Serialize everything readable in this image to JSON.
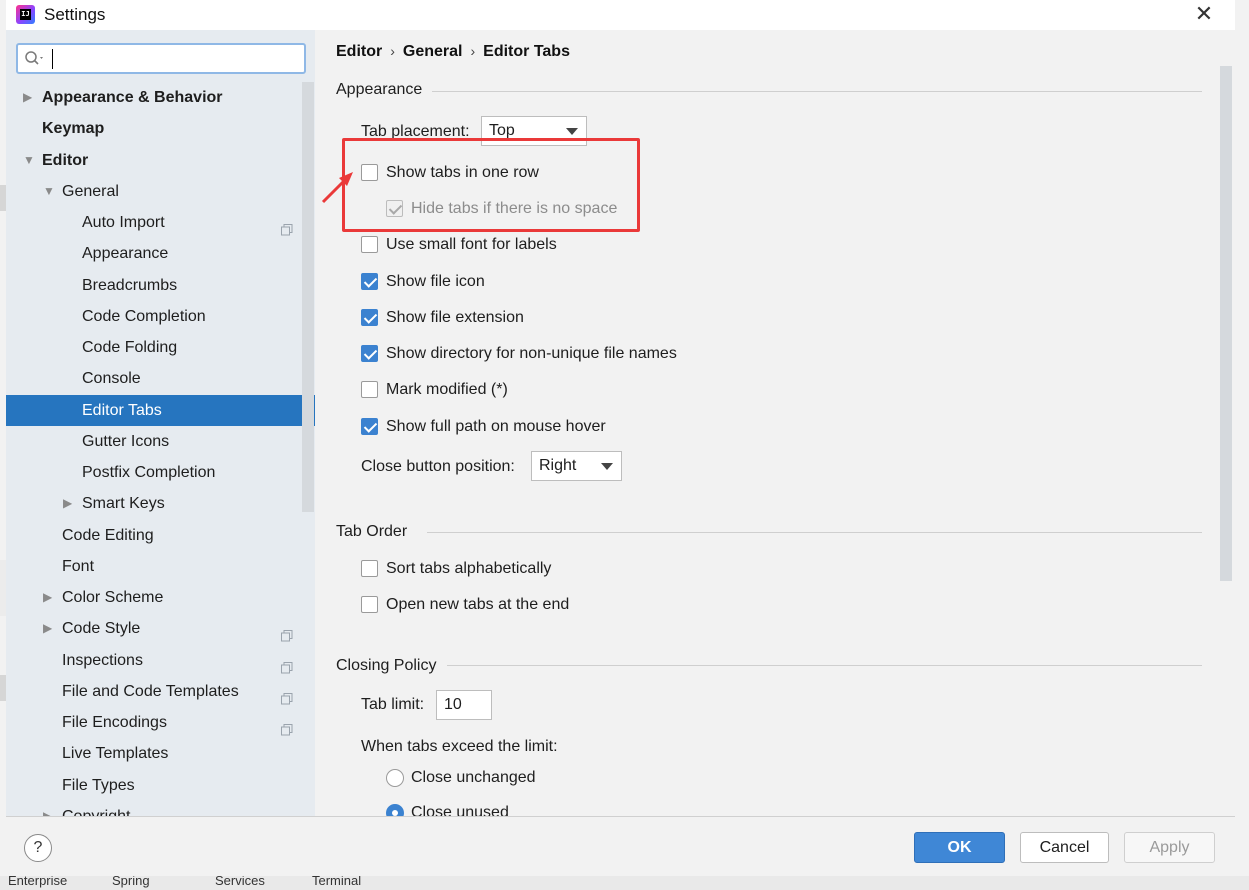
{
  "window": {
    "title": "Settings",
    "app_icon_text": "IJ"
  },
  "search": {
    "value": "",
    "placeholder": ""
  },
  "sidebar": {
    "items": [
      {
        "label": "Appearance & Behavior",
        "bold": true,
        "arrow": "collapsed",
        "level": 0
      },
      {
        "label": "Keymap",
        "bold": true,
        "arrow": "none",
        "level": 0
      },
      {
        "label": "Editor",
        "bold": true,
        "arrow": "expanded",
        "level": 0
      },
      {
        "label": "General",
        "arrow": "expanded",
        "level": 1
      },
      {
        "label": "Auto Import",
        "level": 2,
        "copy_icon": true
      },
      {
        "label": "Appearance",
        "level": 2
      },
      {
        "label": "Breadcrumbs",
        "level": 2
      },
      {
        "label": "Code Completion",
        "level": 2
      },
      {
        "label": "Code Folding",
        "level": 2
      },
      {
        "label": "Console",
        "level": 2
      },
      {
        "label": "Editor Tabs",
        "level": 2,
        "selected": true
      },
      {
        "label": "Gutter Icons",
        "level": 2
      },
      {
        "label": "Postfix Completion",
        "level": 2
      },
      {
        "label": "Smart Keys",
        "level": 2,
        "arrow": "collapsed"
      },
      {
        "label": "Code Editing",
        "level": 1
      },
      {
        "label": "Font",
        "level": 1
      },
      {
        "label": "Color Scheme",
        "level": 1,
        "arrow": "collapsed"
      },
      {
        "label": "Code Style",
        "level": 1,
        "arrow": "collapsed",
        "copy_icon": true
      },
      {
        "label": "Inspections",
        "level": 1,
        "copy_icon": true
      },
      {
        "label": "File and Code Templates",
        "level": 1,
        "copy_icon": true
      },
      {
        "label": "File Encodings",
        "level": 1,
        "copy_icon": true
      },
      {
        "label": "Live Templates",
        "level": 1
      },
      {
        "label": "File Types",
        "level": 1
      },
      {
        "label": "Copyright",
        "level": 1,
        "arrow": "collapsed",
        "copy_icon": true
      }
    ]
  },
  "breadcrumb": [
    "Editor",
    "General",
    "Editor Tabs"
  ],
  "appearance": {
    "title": "Appearance",
    "tab_placement_label": "Tab placement:",
    "tab_placement_value": "Top",
    "show_tabs_one_row": "Show tabs in one row",
    "hide_tabs_no_space": "Hide tabs if there is no space",
    "use_small_font": "Use small font for labels",
    "show_file_icon": "Show file icon",
    "show_file_extension": "Show file extension",
    "show_directory": "Show directory for non-unique file names",
    "mark_modified": "Mark modified (*)",
    "show_full_path": "Show full path on mouse hover",
    "close_button_label": "Close button position:",
    "close_button_value": "Right"
  },
  "tab_order": {
    "title": "Tab Order",
    "sort_alphabetically": "Sort tabs alphabetically",
    "open_at_end": "Open new tabs at the end"
  },
  "closing_policy": {
    "title": "Closing Policy",
    "tab_limit_label": "Tab limit:",
    "tab_limit_value": "10",
    "exceed_label": "When tabs exceed the limit:",
    "close_unchanged": "Close unchanged",
    "close_unused": "Close unused"
  },
  "footer": {
    "help": "?",
    "ok": "OK",
    "cancel": "Cancel",
    "apply": "Apply"
  },
  "background_peek": [
    "Enterprise",
    "Spring",
    "Services",
    "Terminal"
  ],
  "colors": {
    "selection": "#2675bf",
    "checkbox_checked": "#3b82d0",
    "highlight_red": "#ea3939",
    "ok_button": "#3f87d6"
  }
}
